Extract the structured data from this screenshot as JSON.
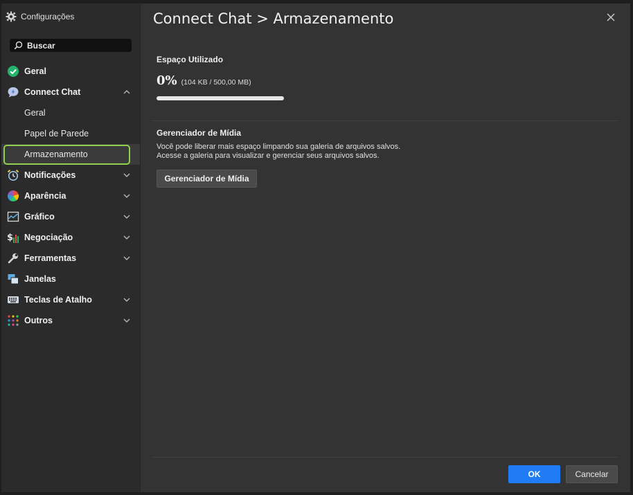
{
  "sidebar": {
    "header": {
      "label": "Configurações",
      "icon": "gear-icon"
    },
    "search": {
      "placeholder": "Buscar",
      "icon": "search-icon"
    },
    "items": [
      {
        "label": "Geral",
        "icon": "check-circle-icon",
        "expandable": false
      },
      {
        "label": "Connect Chat",
        "icon": "chat-bubble-icon",
        "expanded": true,
        "children": [
          {
            "label": "Geral"
          },
          {
            "label": "Papel de Parede"
          },
          {
            "label": "Armazenamento",
            "selected": true
          }
        ]
      },
      {
        "label": "Notificações",
        "icon": "alarm-clock-icon"
      },
      {
        "label": "Aparência",
        "icon": "color-wheel-icon"
      },
      {
        "label": "Gráfico",
        "icon": "chart-icon"
      },
      {
        "label": "Negociação",
        "icon": "dollar-bars-icon"
      },
      {
        "label": "Ferramentas",
        "icon": "wrench-icon"
      },
      {
        "label": "Janelas",
        "icon": "windows-icon",
        "expandable": false
      },
      {
        "label": "Teclas de Atalho",
        "icon": "keyboard-icon"
      },
      {
        "label": "Outros",
        "icon": "dots-grid-icon"
      }
    ]
  },
  "main": {
    "title": "Connect Chat > Armazenamento",
    "storage": {
      "heading": "Espaço Utilizado",
      "percent_label": "0%",
      "detail": "(104 KB / 500,00 MB)",
      "fraction_used": 0.0002
    },
    "media": {
      "heading": "Gerenciador de Mídia",
      "line1": "Você pode liberar mais espaço limpando sua galeria de arquivos salvos.",
      "line2": "Acesse a galeria para visualizar e gerenciar seus arquivos salvos.",
      "button": "Gerenciador de Mídia"
    }
  },
  "footer": {
    "ok": "OK",
    "cancel": "Cancelar"
  },
  "colors": {
    "accent": "#1f7cf4",
    "selection_ring": "#8fd14f",
    "background": "#333333"
  }
}
